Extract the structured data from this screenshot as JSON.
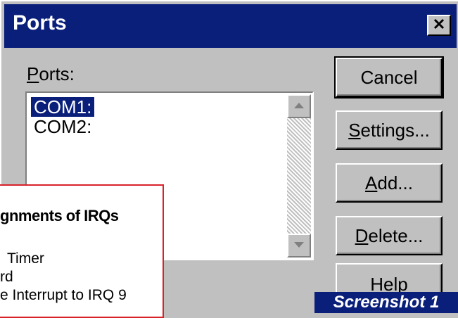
{
  "window": {
    "title": "Ports",
    "close_symbol": "×"
  },
  "ports": {
    "label_first": "P",
    "label_rest": "orts:",
    "items": [
      "COM1:",
      "COM2:"
    ],
    "selected_index": 0
  },
  "buttons": {
    "cancel": {
      "pre": "Cancel",
      "ul": "",
      "post": ""
    },
    "settings": {
      "pre": "",
      "ul": "S",
      "post": "ettings..."
    },
    "add": {
      "pre": "",
      "ul": "A",
      "post": "dd..."
    },
    "delete": {
      "pre": "",
      "ul": "D",
      "post": "elete..."
    },
    "help": {
      "pre": "Help",
      "ul": "",
      "post": ""
    }
  },
  "overlay": {
    "heading": "gnments of IRQs",
    "lines": [
      "Timer",
      "rd",
      "e Interrupt to IRQ 9"
    ]
  },
  "caption": "Screenshot 1",
  "colors": {
    "title_bar": "#0a1f7a",
    "selection": "#0a1f7a",
    "overlay_border": "#d8222a",
    "face": "#c0c0c0"
  },
  "icons": [
    "close-icon",
    "scroll-up-arrow-icon",
    "scroll-down-arrow-icon"
  ]
}
